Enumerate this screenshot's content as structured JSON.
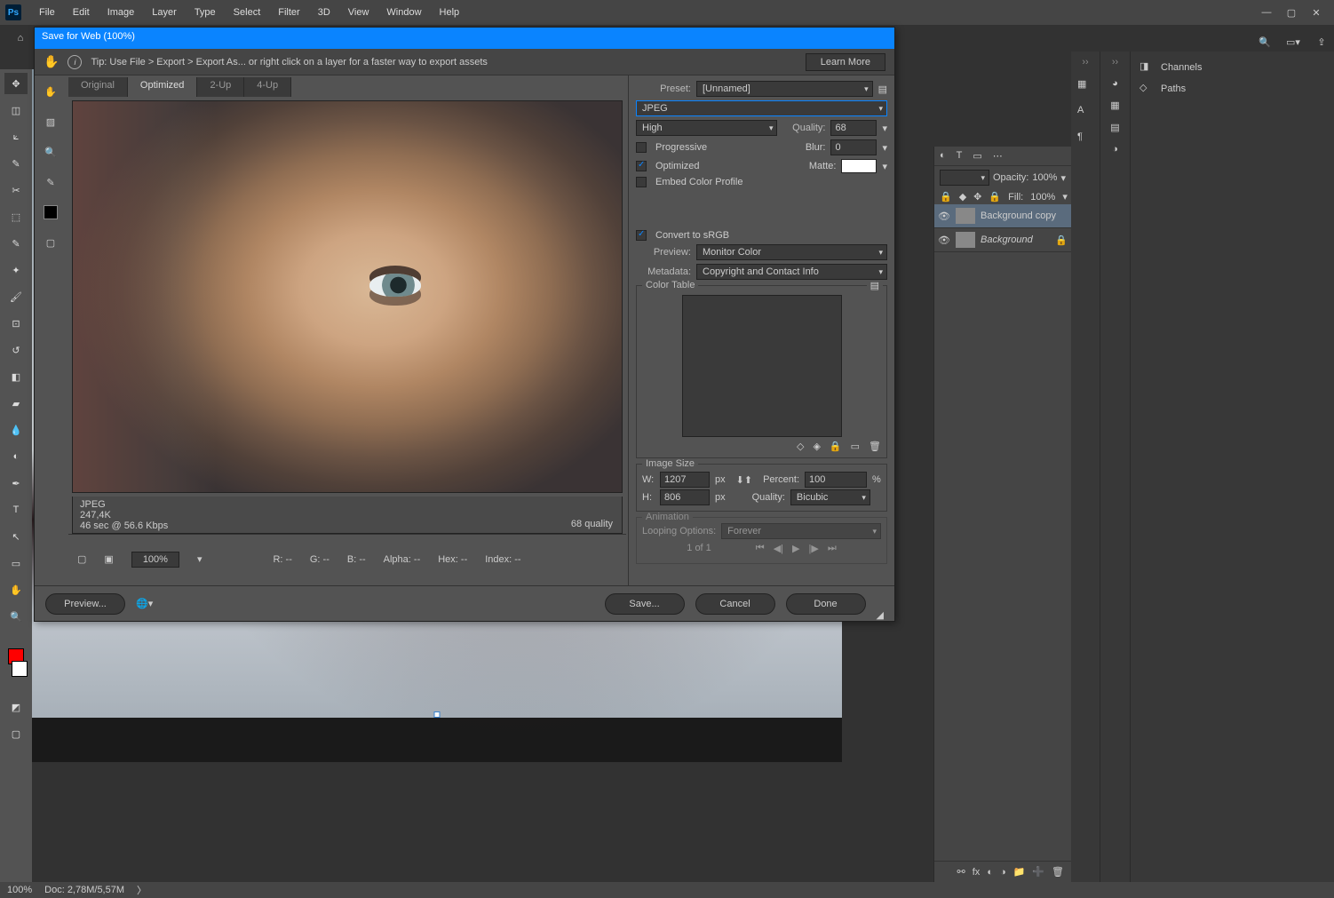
{
  "menu": {
    "items": [
      "File",
      "Edit",
      "Image",
      "Layer",
      "Type",
      "Select",
      "Filter",
      "3D",
      "View",
      "Window",
      "Help"
    ]
  },
  "dialog": {
    "title": "Save for Web (100%)",
    "tip": "Tip: Use File > Export > Export As... or right click on a layer for a faster way to export assets",
    "learn_more": "Learn More",
    "tabs": {
      "original": "Original",
      "optimized": "Optimized",
      "twoup": "2-Up",
      "fourup": "4-Up"
    },
    "info": {
      "format": "JPEG",
      "size": "247,4K",
      "speed": "46 sec @ 56.6 Kbps",
      "quality_label": "68 quality"
    },
    "readout": {
      "r": "R: --",
      "g": "G: --",
      "b": "B: --",
      "alpha": "Alpha: --",
      "hex": "Hex: --",
      "index": "Index: --",
      "zoom": "100%"
    },
    "footer": {
      "preview": "Preview...",
      "save": "Save...",
      "cancel": "Cancel",
      "done": "Done"
    },
    "preset": {
      "label": "Preset:",
      "value": "[Unnamed]"
    },
    "format": "JPEG",
    "quality_menu": "High",
    "progressive": "Progressive",
    "optimized": "Optimized",
    "embed": "Embed Color Profile",
    "quality_label": "Quality:",
    "quality": "68",
    "blur_label": "Blur:",
    "blur": "0",
    "matte_label": "Matte:",
    "convert": "Convert to sRGB",
    "preview_label": "Preview:",
    "preview_value": "Monitor Color",
    "metadata_label": "Metadata:",
    "metadata_value": "Copyright and Contact Info",
    "color_table": "Color Table",
    "image_size": {
      "title": "Image Size",
      "w": "W:",
      "wval": "1207",
      "h": "H:",
      "hval": "806",
      "px": "px",
      "percent_label": "Percent:",
      "percent_val": "100",
      "pct": "%",
      "quality_label": "Quality:",
      "quality_val": "Bicubic"
    },
    "animation": {
      "title": "Animation",
      "looping": "Looping Options:",
      "forever": "Forever",
      "frame": "1 of 1"
    }
  },
  "layers": {
    "row1": "Background copy",
    "row2": "Background",
    "opacity_label": "Opacity:",
    "opacity": "100%",
    "fill_label": "Fill:",
    "fill": "100%"
  },
  "right_panels": {
    "channels": "Channels",
    "paths": "Paths"
  },
  "status": {
    "zoom": "100%",
    "doc": "Doc: 2,78M/5,57M"
  }
}
